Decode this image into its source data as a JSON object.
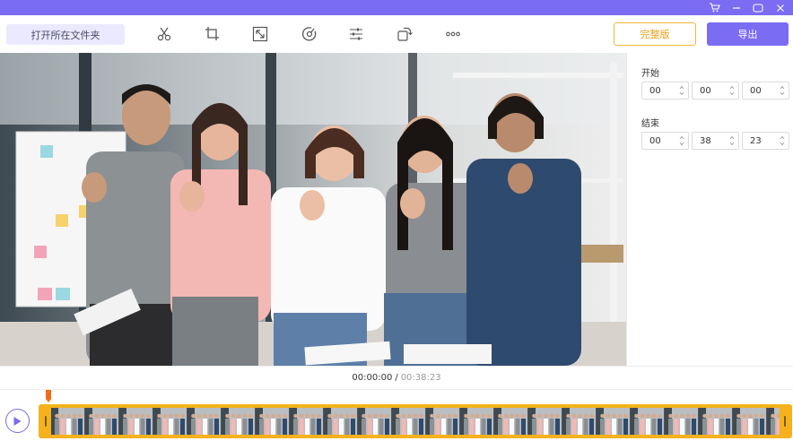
{
  "toolbar": {
    "open_folder_label": "打开所在文件夹",
    "upgrade_label": "完整版",
    "export_label": "导出",
    "tools": [
      {
        "name": "cut-icon"
      },
      {
        "name": "crop-icon"
      },
      {
        "name": "resize-icon"
      },
      {
        "name": "speed-icon"
      },
      {
        "name": "adjust-icon"
      },
      {
        "name": "rotate-icon"
      },
      {
        "name": "more-icon"
      }
    ]
  },
  "window": {
    "controls": [
      "cart-icon",
      "minimize-icon",
      "maximize-icon",
      "close-icon"
    ]
  },
  "trim": {
    "start_label": "开始",
    "end_label": "结束",
    "start": {
      "h": "00",
      "m": "00",
      "s": "00"
    },
    "end": {
      "h": "00",
      "m": "38",
      "s": "23"
    }
  },
  "player": {
    "current_time": "00:00:00",
    "separator": "/",
    "total_time": "00:38:23"
  },
  "colors": {
    "accent": "#7a6cf3",
    "timeline_border": "#f5b21c",
    "upgrade_border": "#f3b73a",
    "playhead": "#f26a1b"
  }
}
